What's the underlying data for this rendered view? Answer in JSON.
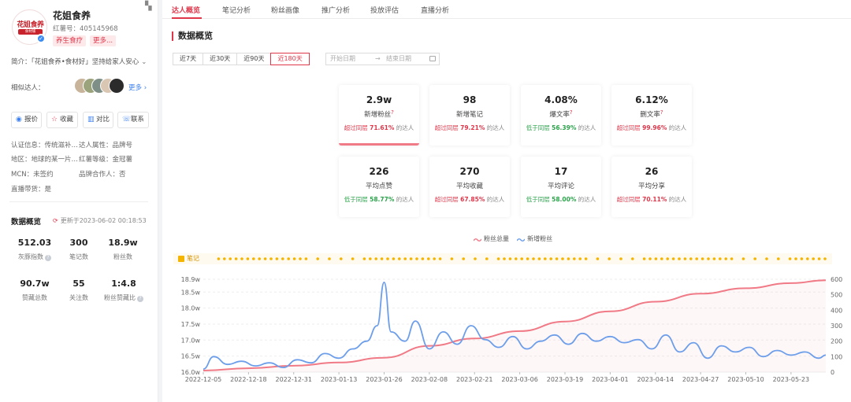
{
  "profile": {
    "logo_line1": "花姐食养",
    "logo_line2": "食材铺",
    "name": "花姐食养",
    "red_id": "红薯号：405145968",
    "tags": [
      "养生食疗",
      "更多..."
    ],
    "intro": "简介：「花姐食养•食材好」坚持给家人安心",
    "related_label": "相似达人：",
    "more_link": "更多",
    "actions": [
      "报价",
      "收藏",
      "对比",
      "联系"
    ],
    "info": {
      "cert": "认证信息：传统滋补…",
      "attr": "达人属性：品牌号",
      "region": "地区：地球的某一片…",
      "level": "红薯等级：金冠薯",
      "mcn": "MCN：未签约",
      "brand_partner": "品牌合作人：否",
      "live": "直播带货：是"
    },
    "overview_title": "数据概览",
    "updated": "更新于2023-06-02 00:18:53",
    "stats": [
      {
        "value": "512.03",
        "label": "灰豚指数",
        "q": true
      },
      {
        "value": "300",
        "label": "笔记数",
        "q": false
      },
      {
        "value": "18.9w",
        "label": "粉丝数",
        "q": false
      },
      {
        "value": "90.7w",
        "label": "赞藏总数",
        "q": false
      },
      {
        "value": "55",
        "label": "关注数",
        "q": false
      },
      {
        "value": "1:4.8",
        "label": "粉丝赞藏比",
        "q": true
      }
    ]
  },
  "tabs": [
    "达人概览",
    "笔记分析",
    "粉丝画像",
    "推广分析",
    "投放评估",
    "直播分析"
  ],
  "page_title": "数据概览",
  "ranges": [
    "近7天",
    "近30天",
    "近90天",
    "近180天"
  ],
  "date_start_placeholder": "开始日期",
  "date_arrow": "→",
  "date_end_placeholder": "结束日期",
  "cards": [
    {
      "value": "2.9w",
      "label": "新增粉丝",
      "q": true,
      "prefix": "超过同层",
      "pct": "71.61%",
      "suffix": "的达人",
      "dir": "up"
    },
    {
      "value": "98",
      "label": "新增笔记",
      "q": false,
      "prefix": "超过同层",
      "pct": "79.21%",
      "suffix": "的达人",
      "dir": "up"
    },
    {
      "value": "4.08%",
      "label": "爆文率",
      "q": true,
      "prefix": "低于同层",
      "pct": "56.39%",
      "suffix": "的达人",
      "dir": "dn"
    },
    {
      "value": "6.12%",
      "label": "删文率",
      "q": true,
      "prefix": "超过同层",
      "pct": "99.96%",
      "suffix": "的达人",
      "dir": "up"
    },
    {
      "value": "226",
      "label": "平均点赞",
      "q": false,
      "prefix": "低于同层",
      "pct": "58.77%",
      "suffix": "的达人",
      "dir": "dn"
    },
    {
      "value": "270",
      "label": "平均收藏",
      "q": false,
      "prefix": "超过同层",
      "pct": "67.85%",
      "suffix": "的达人",
      "dir": "up"
    },
    {
      "value": "17",
      "label": "平均评论",
      "q": false,
      "prefix": "低于同层",
      "pct": "58.00%",
      "suffix": "的达人",
      "dir": "dn"
    },
    {
      "value": "26",
      "label": "平均分享",
      "q": false,
      "prefix": "超过同层",
      "pct": "70.11%",
      "suffix": "的达人",
      "dir": "up"
    }
  ],
  "notes_label": "笔记",
  "colors": {
    "accent": "#e0364a",
    "total_line": "#f07a86",
    "new_line": "#6d9eea",
    "notes": "#f4b400",
    "green": "#2aa34a"
  },
  "chart_data": {
    "type": "line",
    "legend": [
      "粉丝总量",
      "新增粉丝"
    ],
    "x_ticks": [
      "2022-12-05",
      "2022-12-18",
      "2022-12-31",
      "2023-01-13",
      "2023-01-26",
      "2023-02-08",
      "2023-02-21",
      "2023-03-06",
      "2023-03-19",
      "2023-04-01",
      "2023-04-14",
      "2023-04-27",
      "2023-05-10",
      "2023-05-23"
    ],
    "y_left_ticks": [
      "16.0w",
      "16.5w",
      "17.0w",
      "17.5w",
      "18.0w",
      "18.5w",
      "18.9w"
    ],
    "y_right_ticks": [
      "0",
      "100",
      "200",
      "300",
      "400",
      "500",
      "600"
    ],
    "y_left_range": [
      16.0,
      18.9
    ],
    "y_right_range": [
      0,
      600
    ],
    "series": [
      {
        "name": "粉丝总量",
        "axis": "left",
        "x": [
          "2022-12-05",
          "2022-12-18",
          "2022-12-31",
          "2023-01-13",
          "2023-01-26",
          "2023-02-08",
          "2023-02-21",
          "2023-03-06",
          "2023-03-19",
          "2023-04-01",
          "2023-04-14",
          "2023-04-27",
          "2023-05-10",
          "2023-05-23",
          "2023-06-02"
        ],
        "values": [
          16.05,
          16.12,
          16.2,
          16.3,
          16.45,
          16.82,
          17.05,
          17.28,
          17.58,
          17.9,
          18.2,
          18.45,
          18.62,
          18.78,
          18.87
        ]
      },
      {
        "name": "新增粉丝",
        "axis": "right",
        "x": [
          "2022-12-05",
          "2022-12-08",
          "2022-12-12",
          "2022-12-16",
          "2022-12-20",
          "2022-12-24",
          "2022-12-28",
          "2023-01-01",
          "2023-01-05",
          "2023-01-09",
          "2023-01-13",
          "2023-01-17",
          "2023-01-21",
          "2023-01-24",
          "2023-01-26",
          "2023-01-28",
          "2023-02-01",
          "2023-02-04",
          "2023-02-08",
          "2023-02-12",
          "2023-02-16",
          "2023-02-20",
          "2023-02-24",
          "2023-02-28",
          "2023-03-04",
          "2023-03-08",
          "2023-03-12",
          "2023-03-16",
          "2023-03-20",
          "2023-03-24",
          "2023-03-28",
          "2023-04-01",
          "2023-04-05",
          "2023-04-09",
          "2023-04-13",
          "2023-04-17",
          "2023-04-21",
          "2023-04-25",
          "2023-04-29",
          "2023-05-03",
          "2023-05-07",
          "2023-05-11",
          "2023-05-15",
          "2023-05-19",
          "2023-05-23",
          "2023-05-27",
          "2023-05-31",
          "2023-06-02"
        ],
        "values": [
          20,
          100,
          50,
          70,
          40,
          60,
          30,
          80,
          60,
          120,
          90,
          150,
          200,
          300,
          580,
          260,
          200,
          330,
          150,
          260,
          180,
          300,
          210,
          160,
          230,
          150,
          200,
          240,
          180,
          250,
          200,
          230,
          190,
          210,
          150,
          240,
          130,
          190,
          90,
          170,
          130,
          160,
          100,
          140,
          110,
          130,
          90,
          110
        ]
      }
    ]
  }
}
